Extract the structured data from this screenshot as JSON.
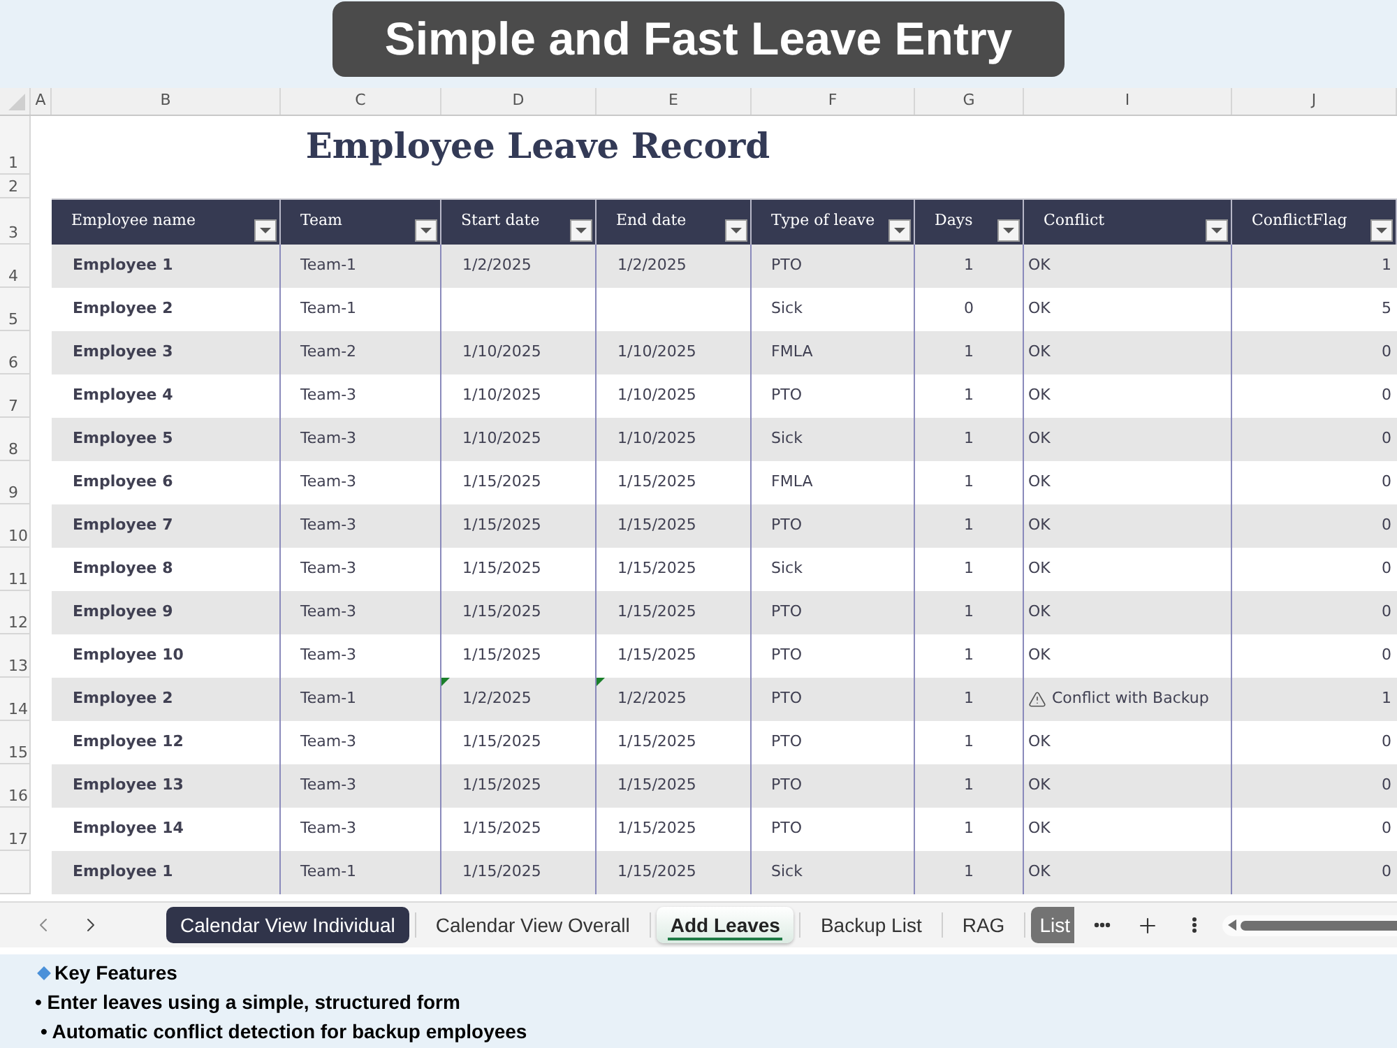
{
  "banner": {
    "title": "Simple and Fast Leave Entry"
  },
  "column_letters": [
    "A",
    "B",
    "C",
    "D",
    "E",
    "F",
    "G",
    "I",
    "J"
  ],
  "sheet_title": {
    "row_numbers": [
      "1",
      "2"
    ],
    "title": "Employee Leave Record"
  },
  "table": {
    "row_number": "3",
    "columns": [
      {
        "label": "Employee name"
      },
      {
        "label": "Team"
      },
      {
        "label": "Start date"
      },
      {
        "label": "End date"
      },
      {
        "label": "Type of leave"
      },
      {
        "label": "Days"
      },
      {
        "label": "Conflict"
      },
      {
        "label": "ConflictFlag"
      }
    ],
    "rows": [
      {
        "row_number": "4",
        "employee": "Employee 1",
        "team": "Team-1",
        "start_date": "1/2/2025",
        "end_date": "1/2/2025",
        "leave_type": "PTO",
        "days": "1",
        "conflict": "OK",
        "conflict_warning": false,
        "conflict_flag": "1",
        "date_marker": false
      },
      {
        "row_number": "5",
        "employee": "Employee 2",
        "team": "Team-1",
        "leave_type": "Sick",
        "days": "0",
        "conflict": "OK",
        "conflict_warning": false,
        "conflict_flag": "5",
        "date_marker": false
      },
      {
        "row_number": "6",
        "employee": "Employee 3",
        "team": "Team-2",
        "start_date": "1/10/2025",
        "end_date": "1/10/2025",
        "leave_type": "FMLA",
        "days": "1",
        "conflict": "OK",
        "conflict_warning": false,
        "conflict_flag": "0",
        "date_marker": false
      },
      {
        "row_number": "7",
        "employee": "Employee 4",
        "team": "Team-3",
        "start_date": "1/10/2025",
        "end_date": "1/10/2025",
        "leave_type": "PTO",
        "days": "1",
        "conflict": "OK",
        "conflict_warning": false,
        "conflict_flag": "0",
        "date_marker": false
      },
      {
        "row_number": "8",
        "employee": "Employee 5",
        "team": "Team-3",
        "start_date": "1/10/2025",
        "end_date": "1/10/2025",
        "leave_type": "Sick",
        "days": "1",
        "conflict": "OK",
        "conflict_warning": false,
        "conflict_flag": "0",
        "date_marker": false
      },
      {
        "row_number": "9",
        "employee": "Employee 6",
        "team": "Team-3",
        "start_date": "1/15/2025",
        "end_date": "1/15/2025",
        "leave_type": "FMLA",
        "days": "1",
        "conflict": "OK",
        "conflict_warning": false,
        "conflict_flag": "0",
        "date_marker": false
      },
      {
        "row_number": "10",
        "employee": "Employee 7",
        "team": "Team-3",
        "start_date": "1/15/2025",
        "end_date": "1/15/2025",
        "leave_type": "PTO",
        "days": "1",
        "conflict": "OK",
        "conflict_warning": false,
        "conflict_flag": "0",
        "date_marker": false
      },
      {
        "row_number": "11",
        "employee": "Employee 8",
        "team": "Team-3",
        "start_date": "1/15/2025",
        "end_date": "1/15/2025",
        "leave_type": "Sick",
        "days": "1",
        "conflict": "OK",
        "conflict_warning": false,
        "conflict_flag": "0",
        "date_marker": false
      },
      {
        "row_number": "12",
        "employee": "Employee 9",
        "team": "Team-3",
        "start_date": "1/15/2025",
        "end_date": "1/15/2025",
        "leave_type": "PTO",
        "days": "1",
        "conflict": "OK",
        "conflict_warning": false,
        "conflict_flag": "0",
        "date_marker": false
      },
      {
        "row_number": "13",
        "employee": "Employee 10",
        "team": "Team-3",
        "start_date": "1/15/2025",
        "end_date": "1/15/2025",
        "leave_type": "PTO",
        "days": "1",
        "conflict": "OK",
        "conflict_warning": false,
        "conflict_flag": "0",
        "date_marker": false
      },
      {
        "row_number": "14",
        "employee": "Employee 2",
        "team": "Team-1",
        "start_date": "1/2/2025",
        "end_date": "1/2/2025",
        "leave_type": "PTO",
        "days": "1",
        "conflict": "Conflict with Backup",
        "conflict_warning": true,
        "conflict_flag": "1",
        "date_marker": true
      },
      {
        "row_number": "15",
        "employee": "Employee 12",
        "team": "Team-3",
        "start_date": "1/15/2025",
        "end_date": "1/15/2025",
        "leave_type": "PTO",
        "days": "1",
        "conflict": "OK",
        "conflict_warning": false,
        "conflict_flag": "0",
        "date_marker": false
      },
      {
        "row_number": "16",
        "employee": "Employee 13",
        "team": "Team-3",
        "start_date": "1/15/2025",
        "end_date": "1/15/2025",
        "leave_type": "PTO",
        "days": "1",
        "conflict": "OK",
        "conflict_warning": false,
        "conflict_flag": "0",
        "date_marker": false
      },
      {
        "row_number": "17",
        "employee": "Employee 14",
        "team": "Team-3",
        "start_date": "1/15/2025",
        "end_date": "1/15/2025",
        "leave_type": "PTO",
        "days": "1",
        "conflict": "OK",
        "conflict_warning": false,
        "conflict_flag": "0",
        "date_marker": false
      },
      {
        "employee": "Employee 1",
        "team": "Team-1",
        "start_date": "1/15/2025",
        "end_date": "1/15/2025",
        "leave_type": "Sick",
        "days": "1",
        "conflict": "OK",
        "conflict_warning": false,
        "conflict_flag": "0",
        "date_marker": false
      }
    ]
  },
  "sheet_tabs": [
    {
      "label": "Calendar View Individual",
      "selected": false,
      "color": "#30344a"
    },
    {
      "label": "Calendar View Overall",
      "selected": false
    },
    {
      "label": "Add Leaves",
      "selected": true
    },
    {
      "label": "Backup List",
      "selected": false
    },
    {
      "label": "RAG",
      "selected": false
    },
    {
      "label": "List",
      "selected": false,
      "color": "#737373"
    }
  ],
  "key_features": {
    "heading": "Key Features",
    "items": [
      "• Enter leaves using a simple, structured form",
      "• Automatic conflict detection for backup employees"
    ]
  }
}
